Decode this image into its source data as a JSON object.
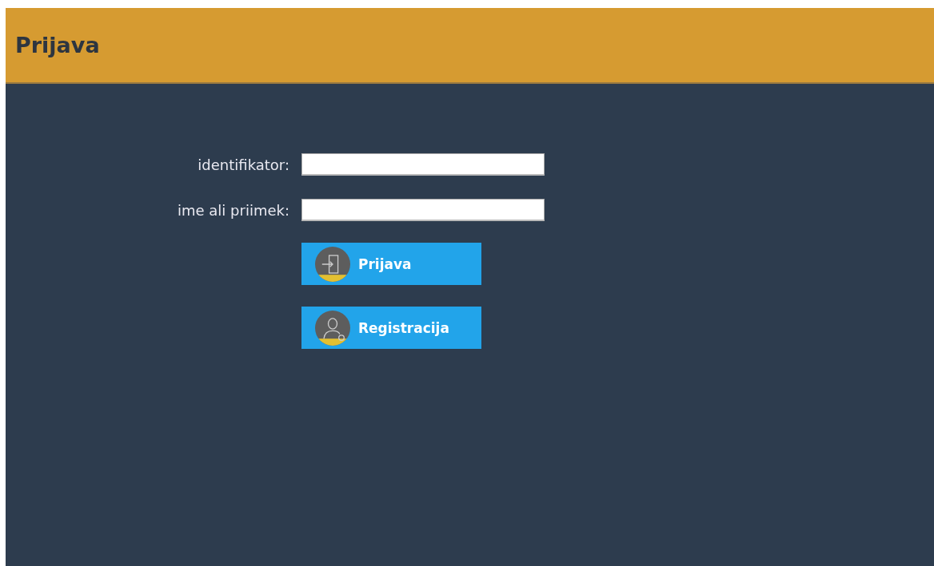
{
  "header": {
    "title": "Prijava"
  },
  "fields": [
    {
      "label": "identifikator:"
    },
    {
      "label": "ime ali priimek:"
    }
  ],
  "buttons": [
    {
      "kind": "login",
      "label": "Prijava"
    },
    {
      "kind": "register",
      "label": "Registracija"
    }
  ]
}
